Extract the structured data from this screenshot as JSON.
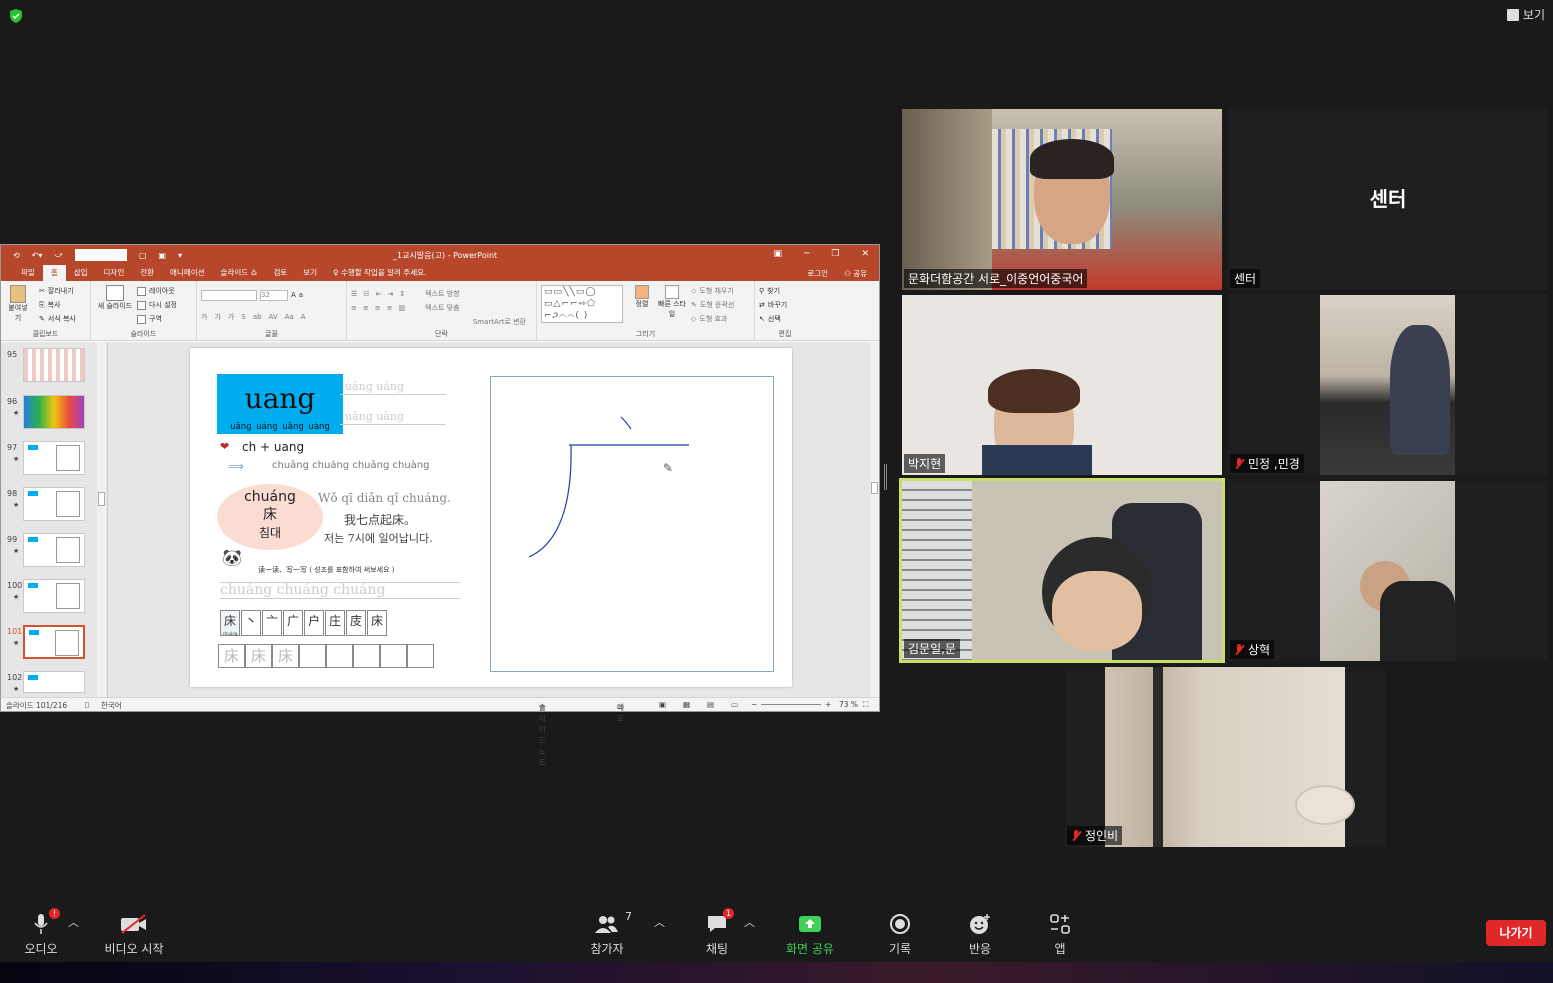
{
  "top": {
    "view_label": "보기"
  },
  "ppt": {
    "title": "_1교시발음(고) - PowerPoint",
    "tabs": [
      "파일",
      "홈",
      "삽입",
      "디자인",
      "전환",
      "애니메이션",
      "슬라이드 쇼",
      "검토",
      "보기"
    ],
    "tell_me": "수행할 작업을 알려 주세요.",
    "login": "로그인",
    "share": "공유",
    "ribbon": {
      "paste": "붙여넣기",
      "cut": "잘라내기",
      "copy": "복사",
      "format_painter": "서식 복사",
      "clipboard": "클립보드",
      "new_slide": "새 슬라이드",
      "layout": "레이아웃",
      "reset": "다시 설정",
      "section": "구역",
      "slides": "슬라이드",
      "font_size": "32",
      "font_group": "글꼴",
      "text_direction": "텍스트 방향",
      "text_align": "텍스트 맞춤",
      "smartart": "SmartArt로 변환",
      "paragraph": "단락",
      "arrange": "정렬",
      "quick_styles": "빠른 스타일",
      "shape_fill": "도형 채우기",
      "shape_outline": "도형 윤곽선",
      "shape_effects": "도형 효과",
      "drawing": "그리기",
      "find": "찾기",
      "replace": "바꾸기",
      "select": "선택",
      "editing": "편집"
    },
    "thumbs": [
      {
        "num": "95",
        "star": ""
      },
      {
        "num": "96",
        "star": "★"
      },
      {
        "num": "97",
        "star": "★"
      },
      {
        "num": "98",
        "star": "★"
      },
      {
        "num": "99",
        "star": "★"
      },
      {
        "num": "100",
        "star": "★"
      },
      {
        "num": "101",
        "star": "★"
      },
      {
        "num": "102",
        "star": "★"
      }
    ],
    "slide": {
      "final": "uang",
      "tones": "uāng  uáng  uǎng  uàng",
      "ghost1": "uāng    uáng",
      "ghost2": "uǎng    uàng",
      "formula": "ch + uang",
      "chuang_tones": "chuāng  chuáng  chuǎng  chuàng",
      "word_pinyin": "chuáng",
      "word_hanzi": "床",
      "word_korean": "침대",
      "sentence_pinyin": "Wǒ qī diǎn qǐ chuáng.",
      "sentence_hanzi": "我七点起床。",
      "sentence_korean": "저는 7시에 일어납니다.",
      "instruction": "读一读、写一写 ( 성조를 표함하여 써보세요 )",
      "ghost3": "chuáng    chuáng    chuáng",
      "strokes": [
        "床",
        "丶",
        "亠",
        "广",
        "户",
        "庄",
        "庋",
        "床"
      ],
      "stroke_first_pinyin": "chuáng",
      "write": [
        "床",
        "床",
        "床",
        "",
        "",
        "",
        "",
        ""
      ]
    },
    "status": {
      "slide_count": "슬라이드 101/216",
      "language": "한국어",
      "notes": "슬라이드 노트",
      "comments": "메모",
      "zoom": "73 %"
    }
  },
  "participants": [
    {
      "name": "문화더함공간 서로_이중언어중국어",
      "muted": false
    },
    {
      "name": "센터",
      "muted": false,
      "center_text": "센터"
    },
    {
      "name": "박지현",
      "muted": false
    },
    {
      "name": "민정 ,민경",
      "muted": true
    },
    {
      "name": "김문일,문",
      "muted": false
    },
    {
      "name": "상혁",
      "muted": true
    },
    {
      "name": "정인비",
      "muted": true
    }
  ],
  "toolbar": {
    "audio": "오디오",
    "audio_badge": "!",
    "video": "비디오 시작",
    "participants": "참가자",
    "participants_count": "7",
    "chat": "채팅",
    "chat_badge": "1",
    "share": "화면 공유",
    "record": "기록",
    "reactions": "반응",
    "apps": "앱",
    "leave": "나가기"
  },
  "colors": {
    "accent_green": "#3fd05a",
    "leave_red": "#e02828",
    "ppt_brand": "#b7472a",
    "active_speaker": "#c8e06a"
  }
}
